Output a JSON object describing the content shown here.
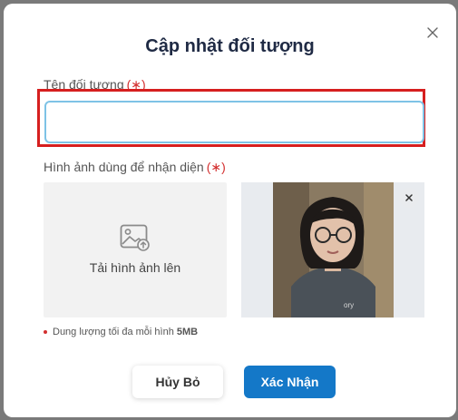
{
  "dialog": {
    "title": "Cập nhật đối tượng",
    "close_icon": "close-icon"
  },
  "form": {
    "name_label": "Tên đối tượng",
    "name_required_mark": "(∗)",
    "name_value": "",
    "image_label": "Hình ảnh dùng để nhận diện",
    "image_required_mark": "(∗)",
    "upload_label": "Tải hình ảnh lên",
    "upload_icon": "image-upload-icon",
    "size_hint": "Dung lượng tối đa mỗi hình",
    "size_limit": "5MB"
  },
  "buttons": {
    "cancel": "Hủy Bỏ",
    "confirm": "Xác Nhận"
  },
  "colors": {
    "title": "#1f2a44",
    "required": "#d32f2f",
    "input_border": "#7ec3e6",
    "highlight": "#d61f1f",
    "confirm_bg": "#1478c8"
  }
}
